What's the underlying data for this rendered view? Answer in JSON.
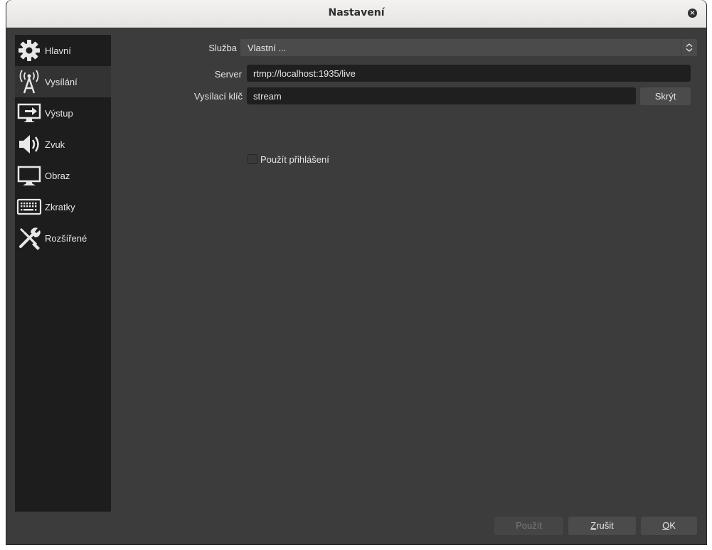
{
  "window": {
    "title": "Nastavení"
  },
  "sidebar": {
    "items": [
      {
        "label": "Hlavní",
        "icon": "gear-icon"
      },
      {
        "label": "Vysílání",
        "icon": "broadcast-antenna-icon",
        "active": true
      },
      {
        "label": "Výstup",
        "icon": "output-monitor-icon"
      },
      {
        "label": "Zvuk",
        "icon": "speaker-icon"
      },
      {
        "label": "Obraz",
        "icon": "monitor-icon"
      },
      {
        "label": "Zkratky",
        "icon": "keyboard-icon"
      },
      {
        "label": "Rozšířené",
        "icon": "tools-icon"
      }
    ]
  },
  "stream": {
    "service_label": "Služba",
    "service_value": "Vlastní ...",
    "server_label": "Server",
    "server_value": "rtmp://localhost:1935/live",
    "key_label": "Vysílací klíč",
    "key_value": "stream",
    "hide_button": "Skrýt",
    "use_auth_label": "Použít přihlášení",
    "use_auth_checked": false
  },
  "footer": {
    "apply_label": "Použít",
    "apply_enabled": false,
    "cancel_first": "Z",
    "cancel_rest": "rušit",
    "ok_first": "O",
    "ok_rest": "K"
  },
  "colors": {
    "window_bg": "#3c3c3c",
    "sidebar_bg": "#1d1d1d",
    "sidebar_active": "#333333",
    "input_bg": "#1f1f1f",
    "button_bg": "#4b4b4b"
  }
}
